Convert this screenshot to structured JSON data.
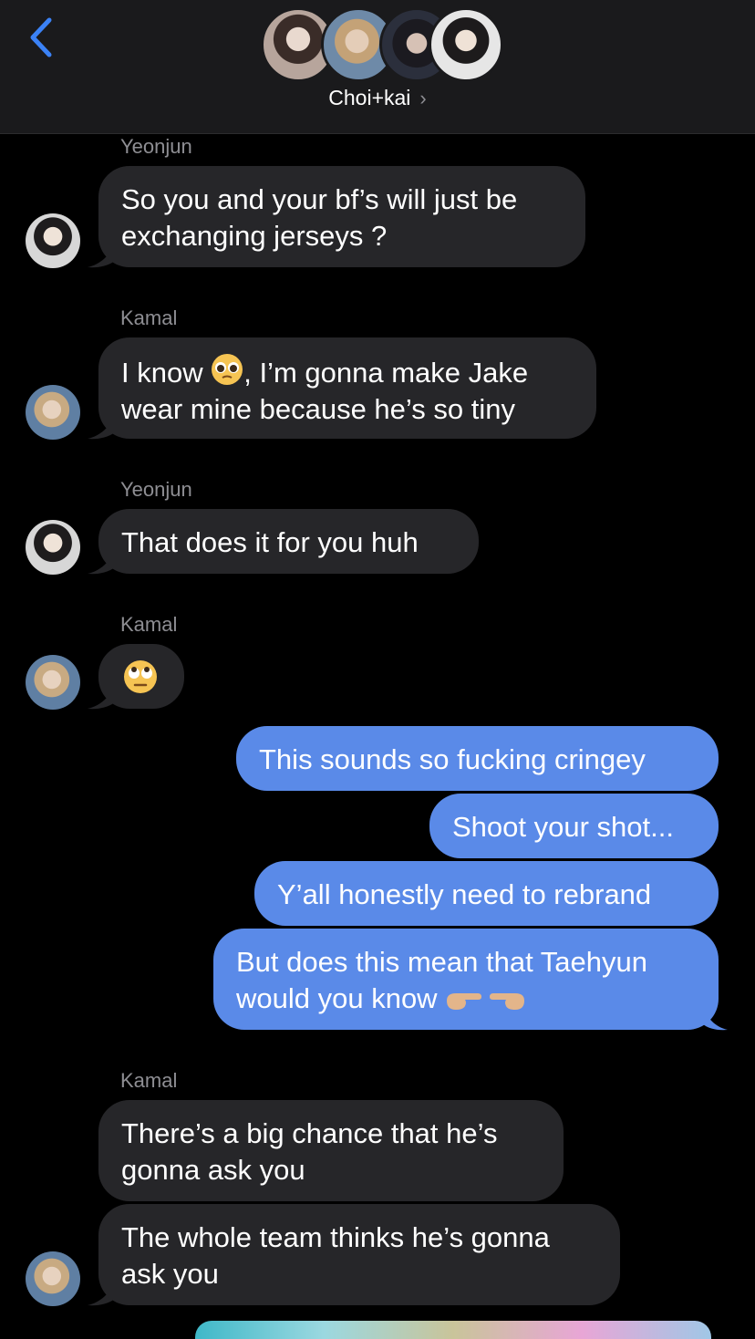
{
  "header": {
    "back_icon": "chevron-left-icon",
    "group_name": "Choi+kai",
    "chevron": "›",
    "accent": "#3b82f6"
  },
  "messages": [
    {
      "sender": "Yeonjun",
      "lines": [
        "So you and your bf’s will just be",
        "exchanging jerseys ?"
      ]
    },
    {
      "sender": "Kamal",
      "lines_a": "I know",
      "lines_a2": ", I’m gonna make Jake",
      "line2": "wear mine because he’s so tiny"
    },
    {
      "sender": "Yeonjun",
      "text": "That does it for you huh"
    },
    {
      "sender": "Kamal",
      "emoji": "face-with-rolling-eyes-icon"
    },
    {
      "text": "This sounds so fucking cringey"
    },
    {
      "text": "Shoot your shot..."
    },
    {
      "text": "Y’all honestly need to rebrand"
    },
    {
      "line1": "But does this mean that Taehyun",
      "line2": "would you know"
    },
    {
      "sender": "Kamal",
      "lines": [
        "There’s a big chance that he’s",
        "gonna ask you"
      ]
    },
    {
      "lines": [
        "The whole team thinks he’s gonna",
        "ask you"
      ]
    }
  ],
  "colors": {
    "received_bubble": "#262629",
    "sent_bubble": "#5a8ae8",
    "sender_label": "#8e8e93"
  }
}
